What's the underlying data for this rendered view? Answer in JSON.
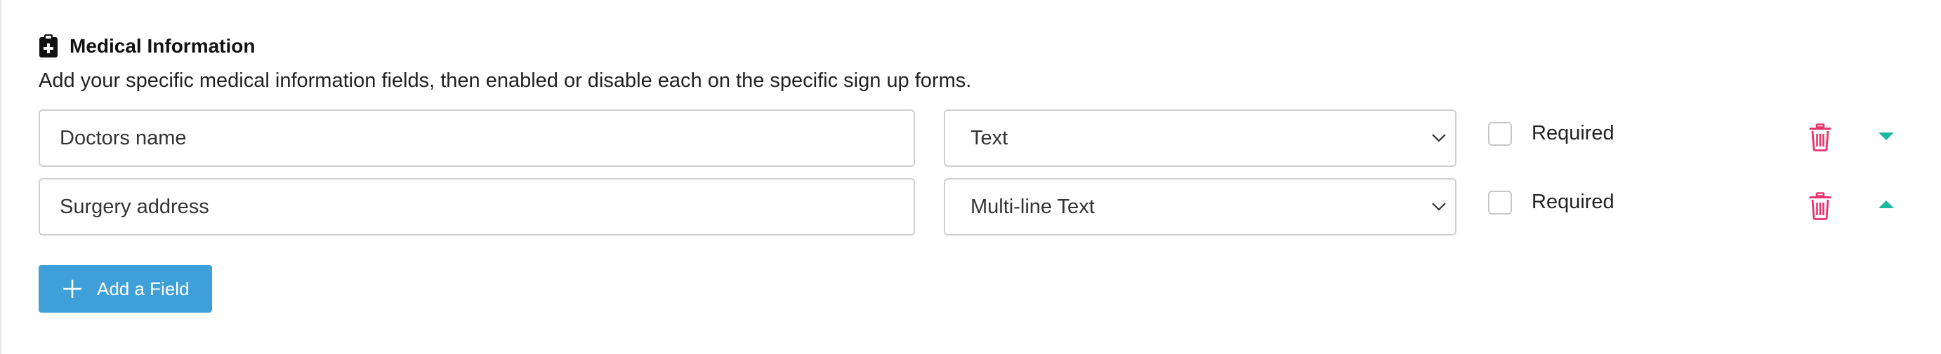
{
  "section": {
    "title": "Medical Information",
    "description": "Add your specific medical information fields, then enabled or disable each on the specific sign up forms.",
    "icon": "clipboard-plus-icon"
  },
  "fields": [
    {
      "name_value": "Doctors name",
      "type_value": "Text",
      "required_label": "Required",
      "required_checked": false,
      "move_direction": "down"
    },
    {
      "name_value": "Surgery address",
      "type_value": "Multi-line Text",
      "required_label": "Required",
      "required_checked": false,
      "move_direction": "up"
    }
  ],
  "add_button": {
    "label": "Add a Field",
    "icon": "plus-icon"
  },
  "colors": {
    "accent_blue": "#3f9fd8",
    "delete_pink": "#e8336b",
    "move_teal": "#1bb9a3",
    "border": "#cfcfcf"
  }
}
